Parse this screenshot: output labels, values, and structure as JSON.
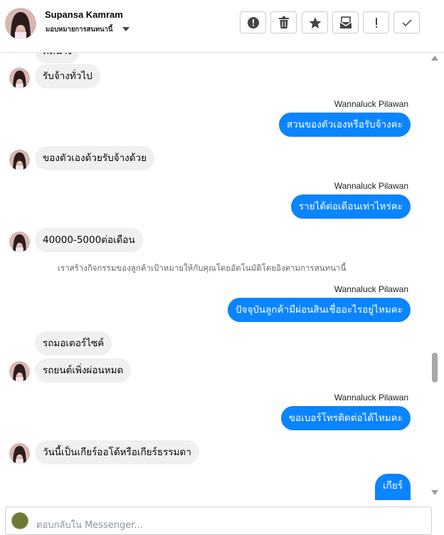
{
  "header": {
    "name": "Supansa Kamram",
    "subtitle": "มอบหมายการสนทนานี้",
    "toolbar": [
      {
        "name": "alert-icon"
      },
      {
        "name": "trash-icon"
      },
      {
        "name": "star-icon"
      },
      {
        "name": "archive-icon"
      },
      {
        "name": "exclamation-icon"
      },
      {
        "name": "check-icon"
      }
    ]
  },
  "messages": {
    "m0": "คิดนาง",
    "m1": "รับจ้างทั่วไป",
    "s2": "Wannaluck Pilawan",
    "m2": "สวนของตัวเองหรือรับจ้างคะ",
    "m3": "ของตัวเองด้วยรับจ้างด้วย",
    "s4": "Wannaluck Pilawan",
    "m4": "รายได้ต่อเดือนเท่าไหร่คะ",
    "m5": "40000-5000ต่อเดือน",
    "sys": "เราสร้างกิจกรรมของลูกค้าเป้าหมายให้กับคุณโดยอัตโนมัติโดยอิงตามการสนทนานี้",
    "s6": "Wannaluck Pilawan",
    "m6": "ปัจจุบันลูกค้ามีผ่อนสินเชื่ออะไรอยู่ไหมคะ",
    "m7": "รถมอเตอร์ไซค์",
    "m8": "รถยนต์เพิ่งผ่อนหมด",
    "s9": "Wannaluck Pilawan",
    "m9": "ขอเบอร์โทรติดต่อได้ไหมคะ",
    "m10": "วันนี้เป็นเกียร์ออโต้หรือเกียร์ธรรมดา",
    "m11": "เกียร์"
  },
  "composer": {
    "placeholder": "ตอบกลับใน Messenger..."
  }
}
